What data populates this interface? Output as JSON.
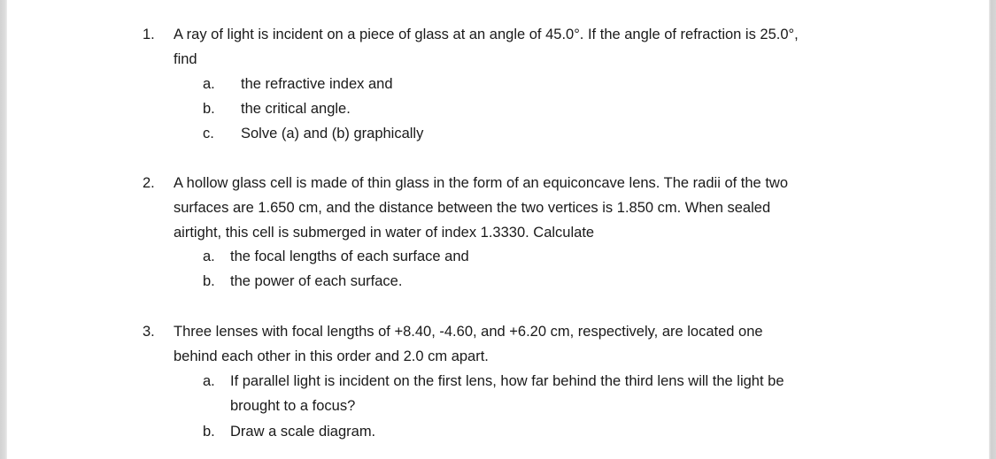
{
  "questions": [
    {
      "number": "1.",
      "lines": [
        "A ray of light is incident on a piece of glass at an angle of 45.0°. If the angle of refraction is 25.0°,",
        "find"
      ],
      "parts": [
        {
          "label": "a.",
          "lines": [
            "the refractive index and"
          ]
        },
        {
          "label": "b.",
          "lines": [
            "the critical angle."
          ]
        },
        {
          "label": "c.",
          "lines": [
            "Solve (a) and (b) graphically"
          ]
        }
      ]
    },
    {
      "number": "2.",
      "lines": [
        "A hollow glass cell is made of thin glass in the form of an equiconcave lens. The radii of the two",
        "surfaces are 1.650 cm, and the distance between the two vertices is 1.850 cm. When sealed",
        "airtight, this cell is submerged in water of index 1.3330. Calculate"
      ],
      "parts": [
        {
          "label": "a.",
          "lines": [
            "the focal lengths of each surface and"
          ]
        },
        {
          "label": "b.",
          "lines": [
            "the power of each surface."
          ]
        }
      ]
    },
    {
      "number": "3.",
      "lines": [
        "Three lenses with focal lengths of +8.40, -4.60, and +6.20 cm, respectively, are located one",
        "behind each other in this order and 2.0 cm apart."
      ],
      "parts": [
        {
          "label": "a.",
          "lines": [
            "If parallel light is incident on the first lens, how far behind the third lens will the light be",
            "brought to a focus?"
          ]
        },
        {
          "label": "b.",
          "lines": [
            "Draw a scale diagram."
          ]
        }
      ]
    }
  ]
}
